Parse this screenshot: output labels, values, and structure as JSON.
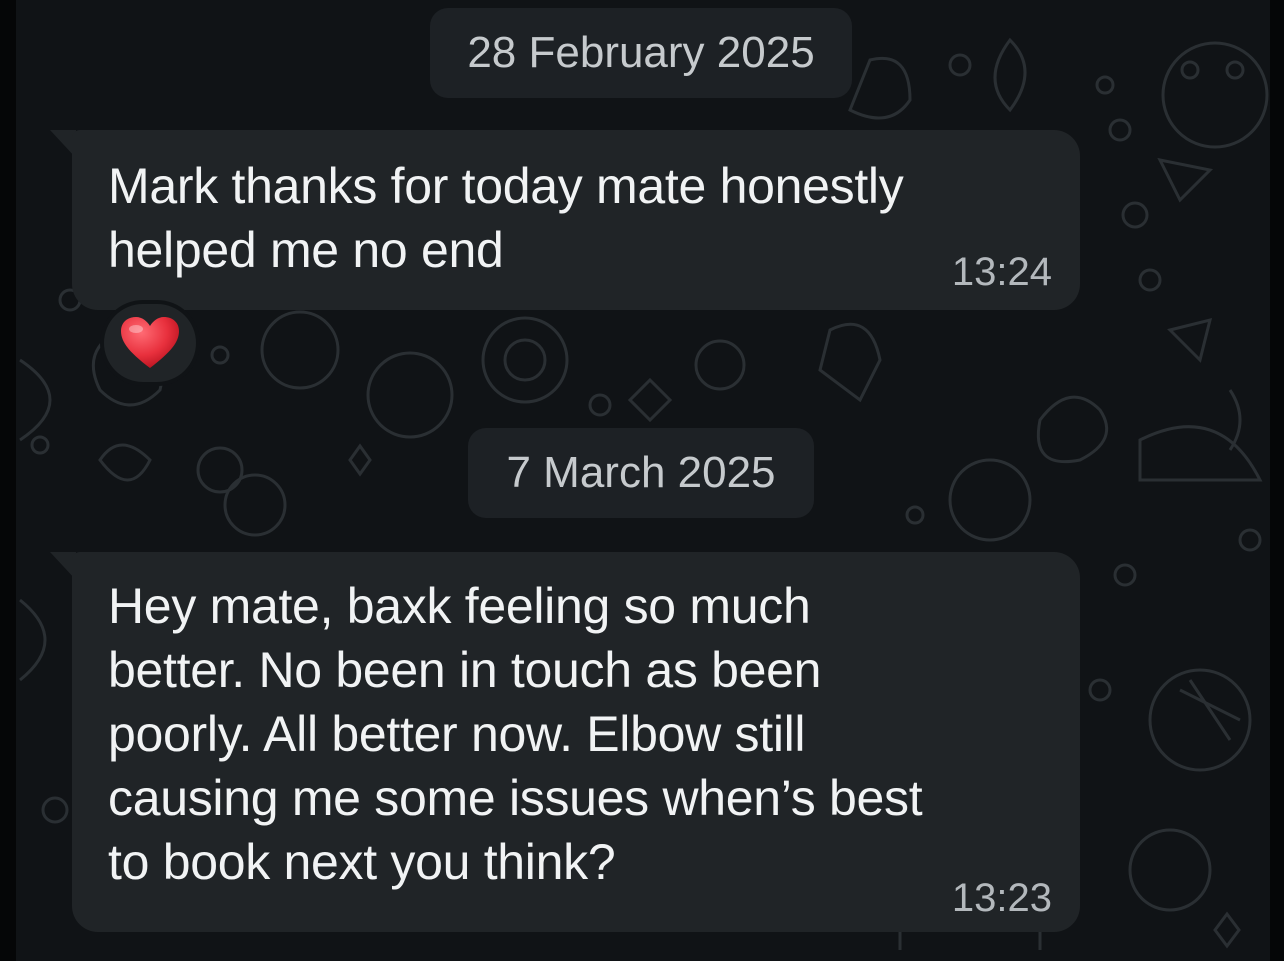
{
  "colors": {
    "background": "#101316",
    "bubble": "#202427",
    "date_pill": "#1d2125",
    "text": "#f1f3f4",
    "timestamp": "#b3b8bc",
    "reaction_heart": "#e8303d"
  },
  "messages": [
    {
      "date_separator": "28 February 2025",
      "text": "Mark thanks for today mate honestly\nhelped me no end",
      "time": "13:24",
      "reaction": "heart-icon"
    },
    {
      "date_separator": "7 March 2025",
      "text": "Hey mate, baxk feeling so much\nbetter. No been in touch as been\npoorly. All better now. Elbow still\ncausing me some issues when’s best\nto book next you think?",
      "time": "13:23"
    }
  ]
}
